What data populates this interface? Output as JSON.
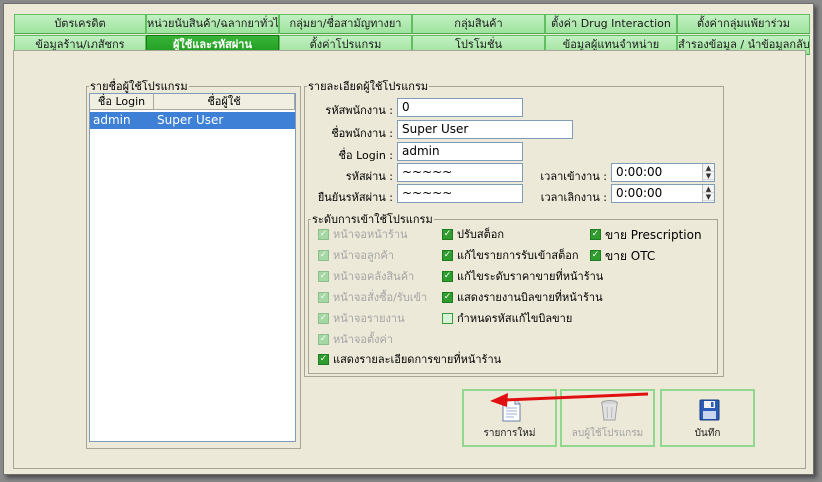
{
  "tabs_row1": [
    {
      "label": "บัตรเครดิต"
    },
    {
      "label": "หน่วยนับสินค้า/ฉลากยาทั่วไป"
    },
    {
      "label": "กลุ่มยา/ชื่อสามัญทางยา"
    },
    {
      "label": "กลุ่มสินค้า"
    },
    {
      "label": "ตั้งค่า Drug Interaction"
    },
    {
      "label": "ตั้งค่ากลุ่มแพ้ยาร่วม"
    }
  ],
  "tabs_row2": [
    {
      "label": "ข้อมูลร้าน/เภสัชกร"
    },
    {
      "label": "ผู้ใช้และรหัสผ่าน"
    },
    {
      "label": "ตั้งค่าโปรแกรม"
    },
    {
      "label": "โปรโมชั่น"
    },
    {
      "label": "ข้อมูลผู้แทนจำหน่าย"
    },
    {
      "label": "สำรองข้อมูล / นำข้อมูลกลับมา"
    }
  ],
  "user_list": {
    "title": "รายชื่อผู้ใช้โปรแกรม",
    "columns": [
      "ชื่อ Login",
      "ชื่อผู้ใช้"
    ],
    "rows": [
      {
        "login": "admin",
        "name": "Super User"
      }
    ]
  },
  "user_details": {
    "title": "รายละเอียดผู้ใช้โปรแกรม",
    "employee_id_label": "รหัสพนักงาน :",
    "employee_id_value": "0",
    "employee_name_label": "ชื่อพนักงาน :",
    "employee_name_value": "Super User",
    "login_label": "ชื่อ Login :",
    "login_value": "admin",
    "password_label": "รหัสผ่าน :",
    "password_value": "~~~~~",
    "confirm_label": "ยืนยันรหัสผ่าน :",
    "confirm_value": "~~~~~",
    "time_in_label": "เวลาเข้างาน :",
    "time_in_value": "0:00:00",
    "time_out_label": "เวลาเลิกงาน :",
    "time_out_value": "0:00:00"
  },
  "access": {
    "title": "ระดับการเข้าใช้โปรแกรม",
    "col1": [
      {
        "label": "หน้าจอหน้าร้าน",
        "checked": true,
        "disabled": true
      },
      {
        "label": "หน้าจอลูกค้า",
        "checked": true,
        "disabled": true
      },
      {
        "label": "หน้าจอคลังสินค้า",
        "checked": true,
        "disabled": true
      },
      {
        "label": "หน้าจอสั่งซื้อ/รับเข้า",
        "checked": true,
        "disabled": true
      },
      {
        "label": "หน้าจอรายงาน",
        "checked": true,
        "disabled": true
      },
      {
        "label": "หน้าจอตั้งค่า",
        "checked": true,
        "disabled": true
      },
      {
        "label": "แสดงรายละเอียดการขายที่หน้าร้าน",
        "checked": true,
        "disabled": false
      }
    ],
    "col2": [
      {
        "label": "ปรับสต็อก",
        "checked": true,
        "disabled": false
      },
      {
        "label": "แก้ไขรายการรับเข้าสต็อก",
        "checked": true,
        "disabled": false
      },
      {
        "label": "แก้ไขระดับราคาขายที่หน้าร้าน",
        "checked": true,
        "disabled": false
      },
      {
        "label": "แสดงรายงานบิลขายที่หน้าร้าน",
        "checked": true,
        "disabled": false
      },
      {
        "label": "กำหนดรหัสแก้ไขบิลขาย",
        "checked": false,
        "disabled": false
      }
    ],
    "col3": [
      {
        "label": "ขาย Prescription",
        "checked": true,
        "disabled": false
      },
      {
        "label": "ขาย OTC",
        "checked": true,
        "disabled": false
      }
    ]
  },
  "buttons": {
    "new_label": "รายการใหม่",
    "delete_label": "ลบผู้ใช้โปรแกรม",
    "save_label": "บันทึก"
  },
  "colors": {
    "tab_active": "#1f9a1f",
    "tab_normal": "#b2ecb2",
    "selection": "#3d80d6",
    "annotation_arrow": "#e01010"
  }
}
